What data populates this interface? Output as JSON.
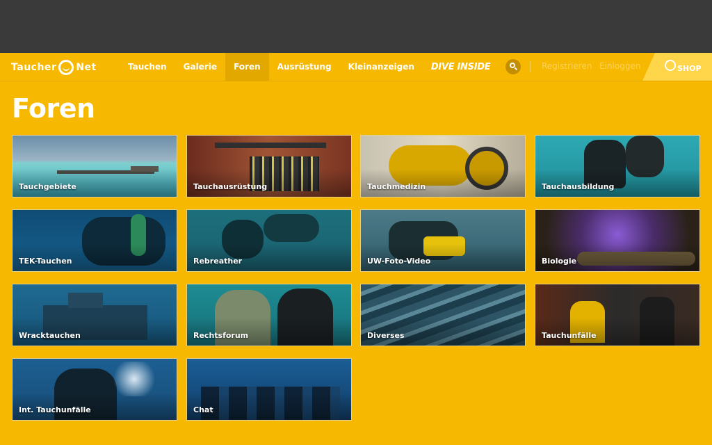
{
  "logo": {
    "left": "Taucher",
    "right": "Net"
  },
  "nav": {
    "items": [
      "Tauchen",
      "Galerie",
      "Foren",
      "Ausrüstung",
      "Kleinanzeigen"
    ],
    "active": "Foren",
    "dive_inside": "DIVE INSIDE",
    "register": "Registrieren",
    "login": "Einloggen",
    "shop": "SHOP"
  },
  "page": {
    "title": "Foren"
  },
  "forums": [
    "Tauchgebiete",
    "Tauchausrüstung",
    "Tauchmedizin",
    "Tauchausbildung",
    "TEK-Tauchen",
    "Rebreather",
    "UW-Foto-Video",
    "Biologie",
    "Wracktauchen",
    "Rechtsforum",
    "Diverses",
    "Tauchunfälle",
    "Int. Tauchunfälle",
    "Chat"
  ],
  "colors": {
    "brand": "#f6b800",
    "topbar": "#3a3a3a"
  }
}
